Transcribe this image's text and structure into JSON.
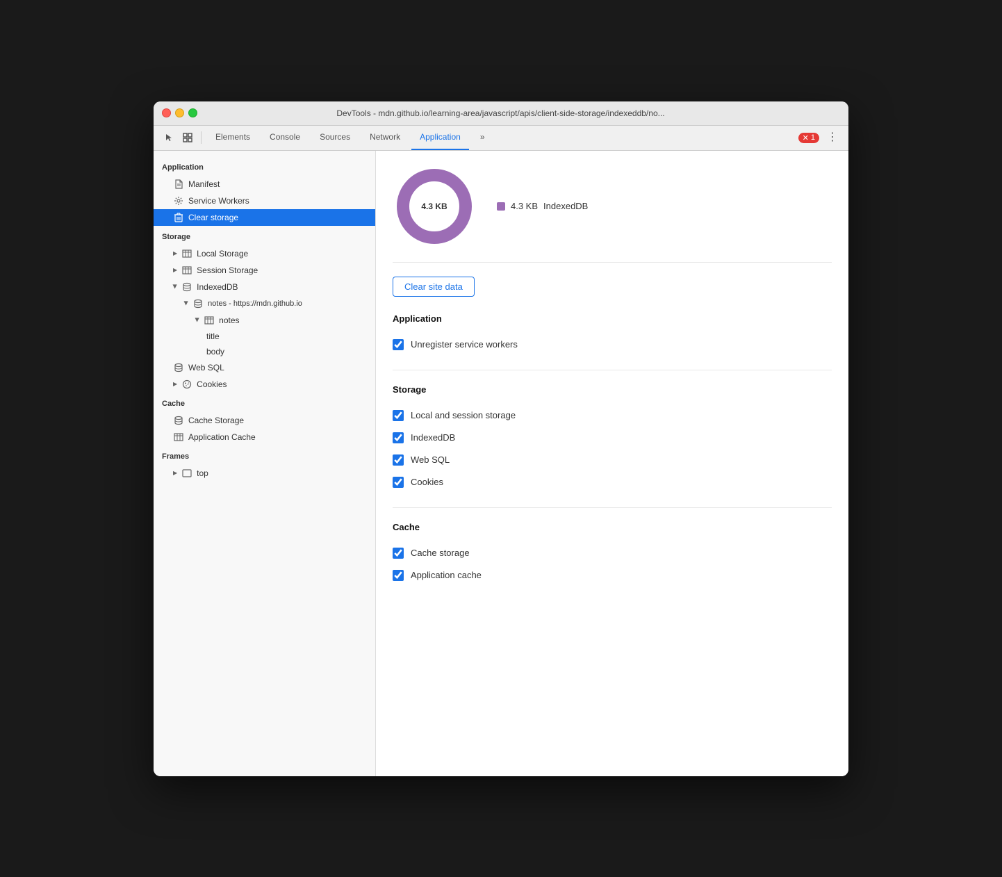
{
  "window": {
    "title": "DevTools - mdn.github.io/learning-area/javascript/apis/client-side-storage/indexeddb/no..."
  },
  "toolbar": {
    "tabs": [
      {
        "label": "Elements",
        "active": false
      },
      {
        "label": "Console",
        "active": false
      },
      {
        "label": "Sources",
        "active": false
      },
      {
        "label": "Network",
        "active": false
      },
      {
        "label": "Application",
        "active": true
      }
    ],
    "more_label": "»",
    "error_count": "1"
  },
  "sidebar": {
    "application_section": "Application",
    "items": [
      {
        "label": "Manifest",
        "icon": "file",
        "indent": 1
      },
      {
        "label": "Service Workers",
        "icon": "gear",
        "indent": 1
      },
      {
        "label": "Clear storage",
        "icon": "trash",
        "indent": 1,
        "active": true
      }
    ],
    "storage_section": "Storage",
    "storage_items": [
      {
        "label": "Local Storage",
        "icon": "table",
        "indent": 1,
        "triangle": true,
        "expanded": false
      },
      {
        "label": "Session Storage",
        "icon": "table",
        "indent": 1,
        "triangle": true,
        "expanded": false
      },
      {
        "label": "IndexedDB",
        "icon": "db",
        "indent": 1,
        "triangle": true,
        "expanded": true
      },
      {
        "label": "notes - https://mdn.github.io",
        "icon": "db",
        "indent": 2,
        "triangle": true,
        "expanded": true
      },
      {
        "label": "notes",
        "icon": "table",
        "indent": 3,
        "triangle": true,
        "expanded": true
      },
      {
        "label": "title",
        "indent": 4
      },
      {
        "label": "body",
        "indent": 4
      },
      {
        "label": "Web SQL",
        "icon": "db",
        "indent": 1
      },
      {
        "label": "Cookies",
        "icon": "cookie",
        "indent": 1,
        "triangle": true,
        "expanded": false
      }
    ],
    "cache_section": "Cache",
    "cache_items": [
      {
        "label": "Cache Storage",
        "icon": "db"
      },
      {
        "label": "Application Cache",
        "icon": "table"
      }
    ],
    "frames_section": "Frames",
    "frames_items": [
      {
        "label": "top",
        "icon": "frame",
        "triangle": true,
        "expanded": false
      }
    ]
  },
  "main": {
    "chart": {
      "size_label": "4.3 KB",
      "legend": [
        {
          "label": "IndexedDB",
          "size": "4.3 KB",
          "color": "#9c6db5"
        }
      ]
    },
    "clear_button": "Clear site data",
    "sections": [
      {
        "title": "Application",
        "checkboxes": [
          {
            "label": "Unregister service workers",
            "checked": true
          }
        ]
      },
      {
        "title": "Storage",
        "checkboxes": [
          {
            "label": "Local and session storage",
            "checked": true
          },
          {
            "label": "IndexedDB",
            "checked": true
          },
          {
            "label": "Web SQL",
            "checked": true
          },
          {
            "label": "Cookies",
            "checked": true
          }
        ]
      },
      {
        "title": "Cache",
        "checkboxes": [
          {
            "label": "Cache storage",
            "checked": true
          },
          {
            "label": "Application cache",
            "checked": true
          }
        ]
      }
    ]
  }
}
